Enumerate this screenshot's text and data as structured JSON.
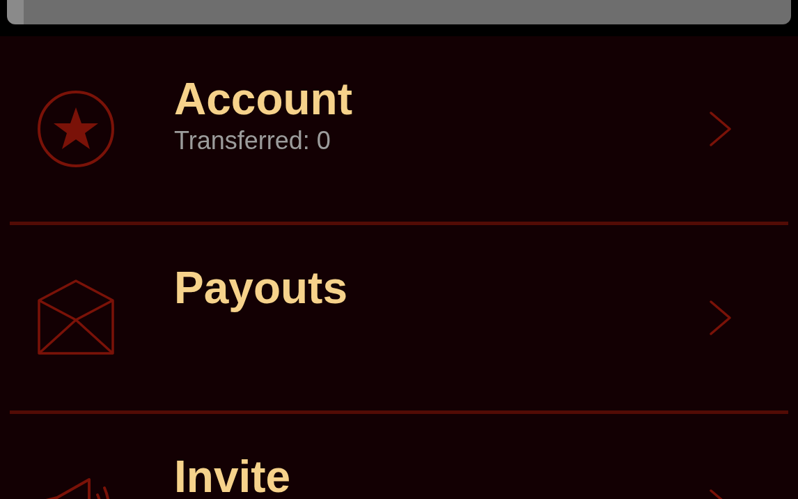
{
  "menu_items": [
    {
      "title": "Account",
      "subtitle": "Transferred: 0"
    },
    {
      "title": "Payouts"
    },
    {
      "title": "Invite"
    }
  ]
}
